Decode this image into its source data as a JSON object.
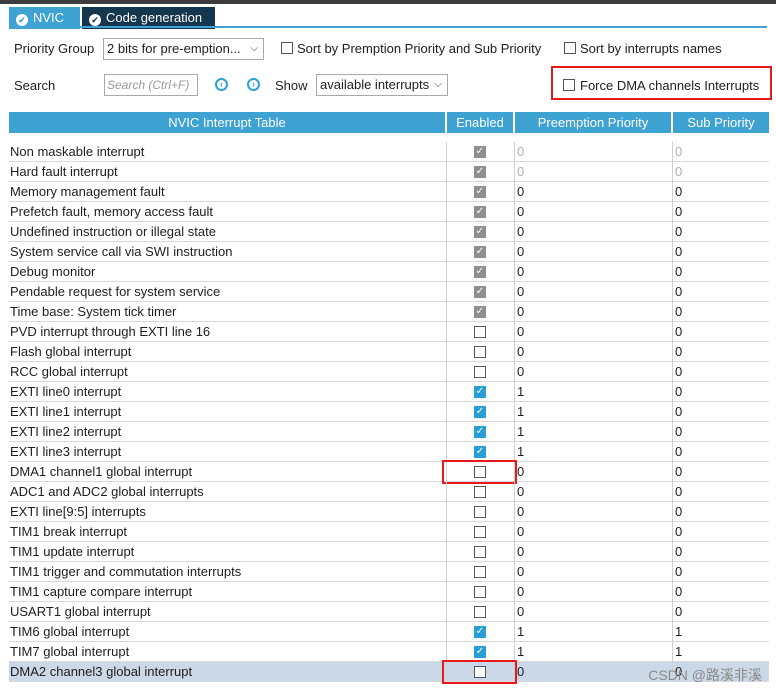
{
  "tabs": [
    {
      "label": "NVIC",
      "icon": "check-circle-icon"
    },
    {
      "label": "Code generation",
      "icon": "check-circle-icon"
    }
  ],
  "toolbar": {
    "priority_group_label": "Priority Group",
    "priority_group_value": "2 bits for pre-emption...",
    "sort_premption_label": "Sort by Premption Priority and Sub Priority",
    "sort_names_label": "Sort by interrupts names",
    "search_label": "Search",
    "search_placeholder": "Search (Ctrl+F)",
    "show_label": "Show",
    "show_value": "available interrupts",
    "force_dma_label": "Force DMA channels Interrupts"
  },
  "table": {
    "headers": [
      "NVIC Interrupt Table",
      "Enabled",
      "Preemption Priority",
      "Sub Priority"
    ],
    "rows": [
      {
        "name": "Non maskable interrupt",
        "enabled": "checked-disabled",
        "preemption": "0",
        "sub": "0",
        "dim": true
      },
      {
        "name": "Hard fault interrupt",
        "enabled": "checked-disabled",
        "preemption": "0",
        "sub": "0",
        "dim": true
      },
      {
        "name": "Memory management fault",
        "enabled": "checked-disabled",
        "preemption": "0",
        "sub": "0"
      },
      {
        "name": "Prefetch fault, memory access fault",
        "enabled": "checked-disabled",
        "preemption": "0",
        "sub": "0"
      },
      {
        "name": "Undefined instruction or illegal state",
        "enabled": "checked-disabled",
        "preemption": "0",
        "sub": "0"
      },
      {
        "name": "System service call via SWI instruction",
        "enabled": "checked-disabled",
        "preemption": "0",
        "sub": "0"
      },
      {
        "name": "Debug monitor",
        "enabled": "checked-disabled",
        "preemption": "0",
        "sub": "0"
      },
      {
        "name": "Pendable request for system service",
        "enabled": "checked-disabled",
        "preemption": "0",
        "sub": "0"
      },
      {
        "name": "Time base: System tick timer",
        "enabled": "checked-disabled",
        "preemption": "0",
        "sub": "0"
      },
      {
        "name": "PVD interrupt through EXTI line 16",
        "enabled": "unchecked",
        "preemption": "0",
        "sub": "0"
      },
      {
        "name": "Flash global interrupt",
        "enabled": "unchecked",
        "preemption": "0",
        "sub": "0"
      },
      {
        "name": "RCC global interrupt",
        "enabled": "unchecked",
        "preemption": "0",
        "sub": "0"
      },
      {
        "name": "EXTI line0 interrupt",
        "enabled": "checked",
        "preemption": "1",
        "sub": "0"
      },
      {
        "name": "EXTI line1 interrupt",
        "enabled": "checked",
        "preemption": "1",
        "sub": "0"
      },
      {
        "name": "EXTI line2 interrupt",
        "enabled": "checked",
        "preemption": "1",
        "sub": "0"
      },
      {
        "name": "EXTI line3 interrupt",
        "enabled": "checked",
        "preemption": "1",
        "sub": "0"
      },
      {
        "name": "DMA1 channel1 global interrupt",
        "enabled": "unchecked",
        "preemption": "0",
        "sub": "0",
        "highlight": true
      },
      {
        "name": "ADC1 and ADC2 global interrupts",
        "enabled": "unchecked",
        "preemption": "0",
        "sub": "0"
      },
      {
        "name": "EXTI line[9:5] interrupts",
        "enabled": "unchecked",
        "preemption": "0",
        "sub": "0"
      },
      {
        "name": "TIM1 break interrupt",
        "enabled": "unchecked",
        "preemption": "0",
        "sub": "0"
      },
      {
        "name": "TIM1 update interrupt",
        "enabled": "unchecked",
        "preemption": "0",
        "sub": "0"
      },
      {
        "name": "TIM1 trigger and commutation interrupts",
        "enabled": "unchecked",
        "preemption": "0",
        "sub": "0"
      },
      {
        "name": "TIM1 capture compare interrupt",
        "enabled": "unchecked",
        "preemption": "0",
        "sub": "0"
      },
      {
        "name": "USART1 global interrupt",
        "enabled": "unchecked",
        "preemption": "0",
        "sub": "0"
      },
      {
        "name": "TIM6 global interrupt",
        "enabled": "checked",
        "preemption": "1",
        "sub": "1"
      },
      {
        "name": "TIM7 global interrupt",
        "enabled": "checked",
        "preemption": "1",
        "sub": "1"
      },
      {
        "name": "DMA2 channel3 global interrupt",
        "enabled": "unchecked",
        "preemption": "0",
        "sub": "0",
        "highlight": true,
        "selected": true
      }
    ]
  },
  "watermark": "CSDN @路溪非溪",
  "colors": {
    "accent": "#3ea2d3",
    "tab_dark": "#15364f",
    "checkbox_checked": "#2a9fd6",
    "annotation_red": "#e8191b",
    "selected_row": "#cad8e8"
  }
}
